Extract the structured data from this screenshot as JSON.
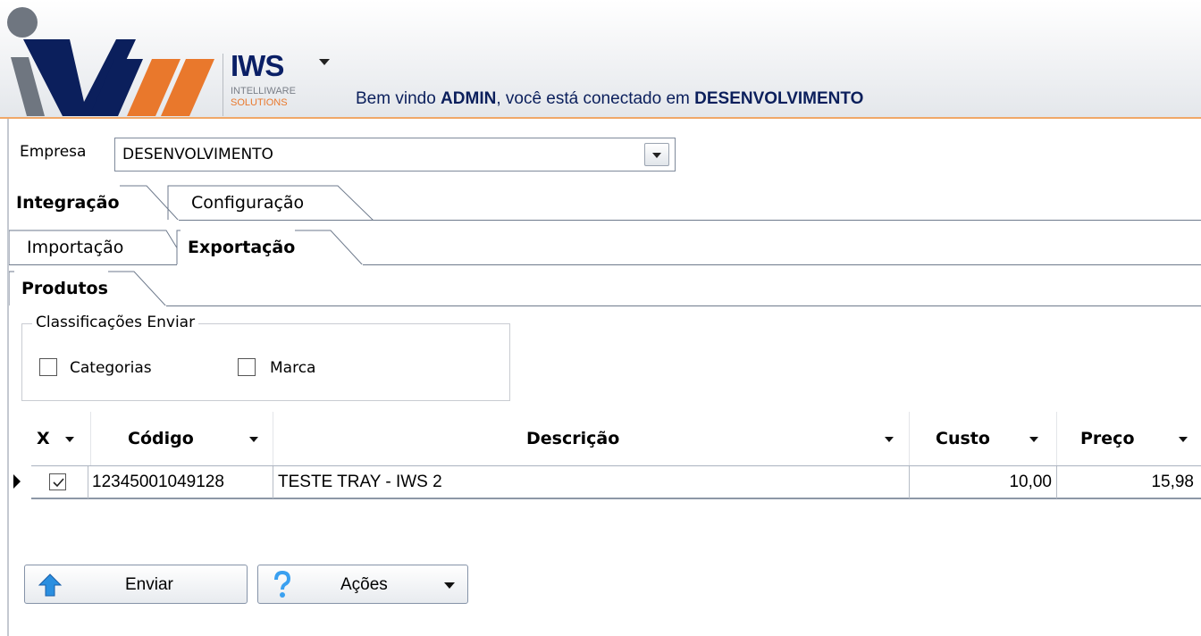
{
  "header": {
    "brand": "IWS",
    "brand_sub1": "INTELLIWARE",
    "brand_sub2": "SOLUTIONS",
    "welcome_prefix": "Bem vindo ",
    "user": "ADMIN",
    "welcome_middle": ", você está conectado em ",
    "company": "DESENVOLVIMENTO",
    "colors": {
      "brand_blue": "#0a1f66",
      "brand_orange": "#e9782c"
    }
  },
  "empresa": {
    "label": "Empresa",
    "value": "DESENVOLVIMENTO"
  },
  "tabs_level1": [
    {
      "label": "Integração",
      "active": true
    },
    {
      "label": "Configuração",
      "active": false
    }
  ],
  "tabs_level2": [
    {
      "label": "Importação",
      "active": false
    },
    {
      "label": "Exportação",
      "active": true
    }
  ],
  "tabs_level3": [
    {
      "label": "Produtos",
      "active": true
    }
  ],
  "classificacoes": {
    "title": "Classificações Enviar",
    "options": [
      {
        "label": "Categorias",
        "checked": false
      },
      {
        "label": "Marca",
        "checked": false
      }
    ]
  },
  "grid": {
    "columns": [
      "X",
      "Código",
      "Descrição",
      "Custo",
      "Preço"
    ],
    "rows": [
      {
        "selected": true,
        "codigo": "12345001049128",
        "descricao": "TESTE TRAY - IWS 2",
        "custo": "10,00",
        "preco": "15,98"
      }
    ]
  },
  "actions": {
    "enviar": "Enviar",
    "acoes": "Ações",
    "icons": {
      "enviar": "up-arrow-icon",
      "acoes": "help-icon"
    }
  }
}
